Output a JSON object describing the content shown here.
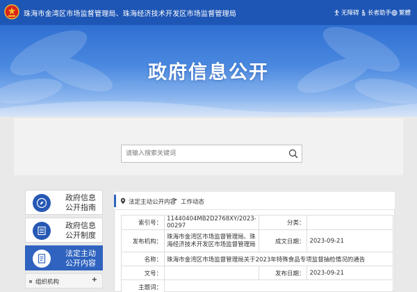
{
  "header": {
    "site_title": "珠海市金湾区市场监督管理局、珠海经济技术开发区市场监督管理局",
    "tools": [
      {
        "label": "无障碍",
        "icon": "accessibility-icon"
      },
      {
        "label": "长者助手",
        "icon": "elder-assist-icon"
      },
      {
        "label": "繁體",
        "icon": "traditional-chinese-icon"
      }
    ]
  },
  "banner": {
    "title": "政府信息公开"
  },
  "search": {
    "placeholder": "请输入搜索关键词"
  },
  "sidebar": {
    "items": [
      {
        "label_line1": "政府信息",
        "label_line2": "公开指南",
        "icon": "compass-icon"
      },
      {
        "label_line1": "政府信息",
        "label_line2": "公开制度",
        "icon": "list-doc-icon"
      },
      {
        "label_line1": "法定主动",
        "label_line2": "公开内容",
        "icon": "document-icon"
      }
    ],
    "sub_item": {
      "label": "组织机构",
      "toggle": "+"
    }
  },
  "breadcrumb": {
    "items": [
      "法定主动公开内容",
      "工作动态"
    ],
    "separator": ">"
  },
  "meta": {
    "index_label": "索引号：",
    "index_value": "11440404MB2D2768XY/2023-00297",
    "category_label": "分类：",
    "category_value": "",
    "publisher_label": "发布机构：",
    "publisher_value": "珠海市金湾区市场监督管理局、珠海经济技术开发区市场监督管理局",
    "created_label": "成文日期：",
    "created_value": "2023-09-21",
    "name_label": "名称：",
    "name_value": "珠海市金湾区市场监督管理局关于2023年特殊食品专项监督抽检情况的通告",
    "docno_label": "文号：",
    "docno_value": "",
    "pubdate_label": "发布日期：",
    "pubdate_value": "2023-09-21",
    "subject_label": "主题词：",
    "subject_value": ""
  },
  "colors": {
    "primary": "#1e56b5",
    "active": "#2f63bf"
  }
}
